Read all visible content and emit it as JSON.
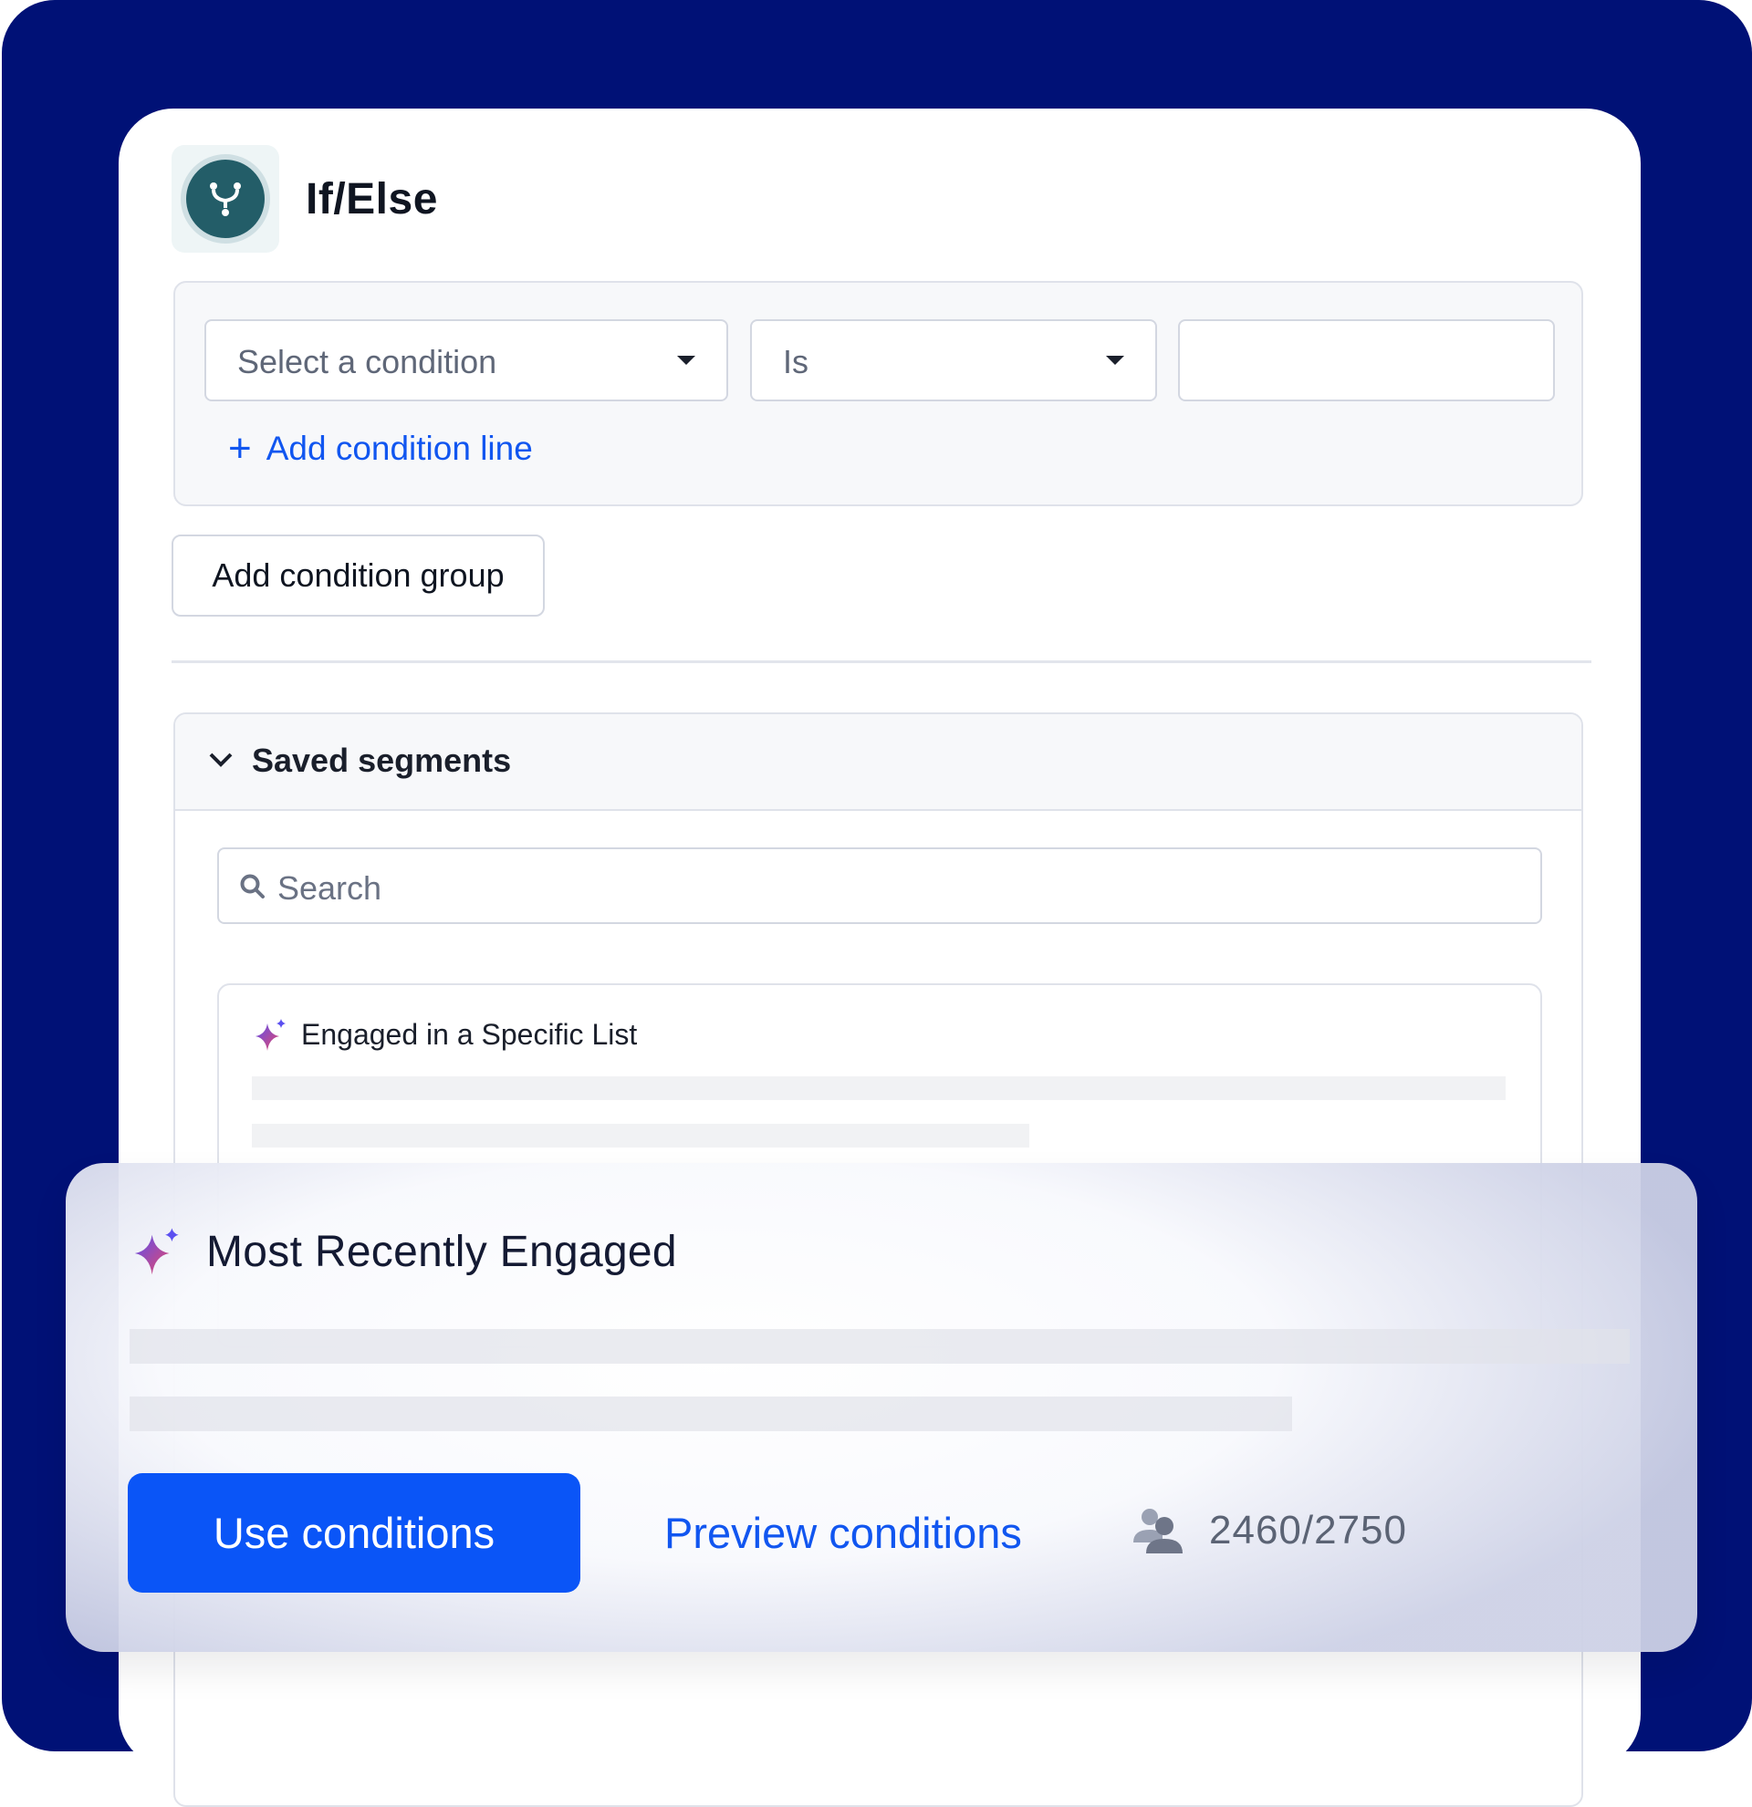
{
  "header": {
    "title": "If/Else",
    "icon": "branch-split-icon"
  },
  "condition_row": {
    "condition_select": {
      "value": "Select a condition"
    },
    "operator_select": {
      "value": "Is"
    },
    "value_input": {
      "value": ""
    },
    "add_line_label": "Add condition line"
  },
  "add_group_label": "Add condition group",
  "saved_segments": {
    "label": "Saved segments",
    "search_placeholder": "Search",
    "items": [
      {
        "name": "Engaged in a Specific List",
        "icon": "sparkle-icon"
      }
    ]
  },
  "highlighted_segment": {
    "name": "Most Recently Engaged",
    "use_label": "Use conditions",
    "preview_label": "Preview conditions",
    "count": "2460/2750",
    "count_icon": "people-icon"
  },
  "colors": {
    "background": "#001176",
    "accent": "#0a55f7",
    "link": "#1156f0",
    "icon_teal": "#235d68"
  }
}
